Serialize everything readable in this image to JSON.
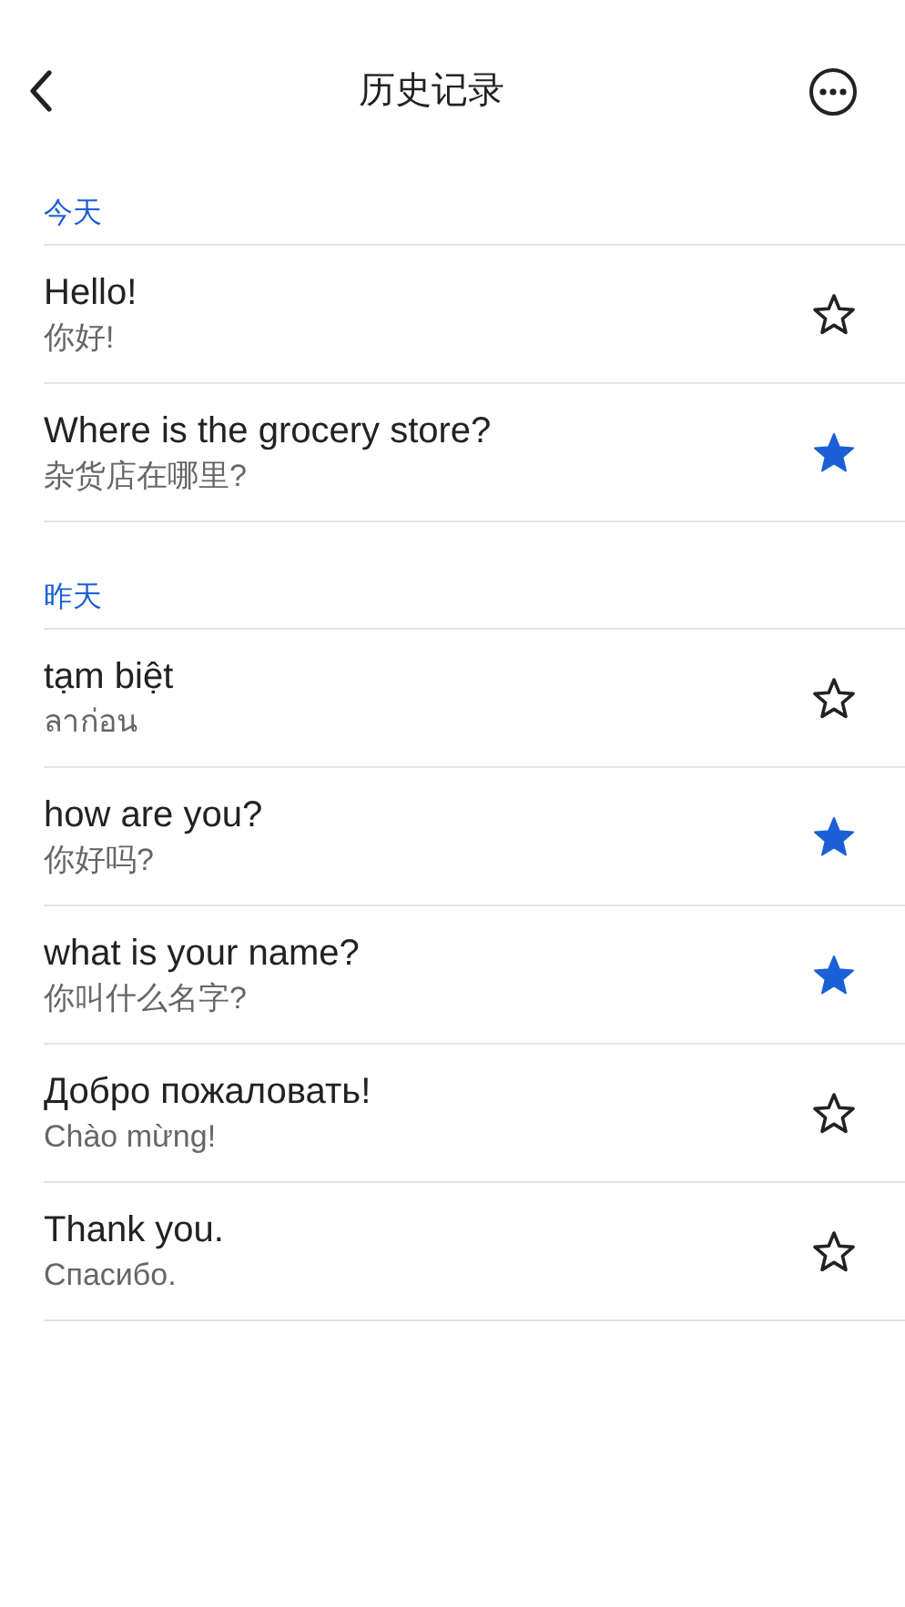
{
  "header": {
    "title": "历史记录"
  },
  "sections": [
    {
      "label": "今天",
      "items": [
        {
          "source": "Hello!",
          "translation": "你好!",
          "starred": false
        },
        {
          "source": "Where is the grocery store?",
          "translation": "杂货店在哪里?",
          "starred": true
        }
      ]
    },
    {
      "label": "昨天",
      "items": [
        {
          "source": "tạm biệt",
          "translation": "ลาก่อน",
          "starred": false
        },
        {
          "source": "how are you?",
          "translation": "你好吗?",
          "starred": true
        },
        {
          "source": "what is your name?",
          "translation": "你叫什么名字?",
          "starred": true
        },
        {
          "source": "Добро пожаловать!",
          "translation": "Chào mừng!",
          "starred": false
        },
        {
          "source": "Thank you.",
          "translation": "Спасибо.",
          "starred": false
        }
      ]
    }
  ]
}
